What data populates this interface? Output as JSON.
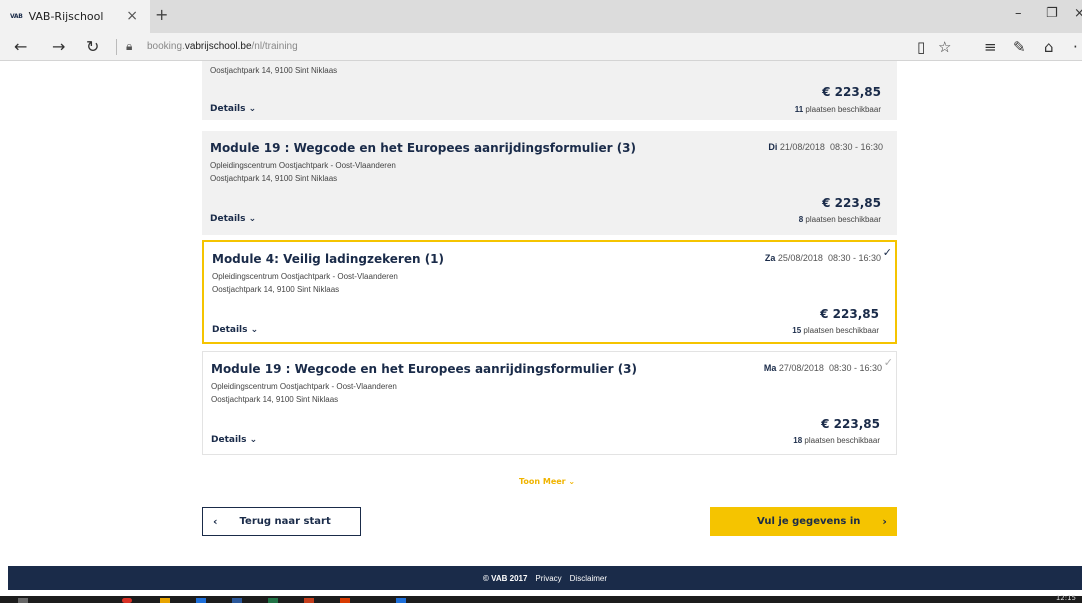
{
  "browser": {
    "tab_favicon": "VAB",
    "tab_title": "VAB-Rijschool",
    "tab_close": "×",
    "new_tab": "+",
    "url_prefix": "booking.",
    "url_domain": "vabrijschool.be",
    "url_path": "/nl/training"
  },
  "top_partial": {
    "address": "Oostjachtpark 14, 9100 Sint Niklaas",
    "price": "€ 223,85",
    "details": "Details",
    "avail_count": "11",
    "avail_text": "plaatsen beschikbaar"
  },
  "cards": [
    {
      "title": "Module 19 : Wegcode en het Europees aanrijdingsformulier (3)",
      "location": "Opleidingscentrum Oostjachtpark - Oost-Vlaanderen",
      "address": "Oostjachtpark 14, 9100 Sint Niklaas",
      "day": "Di",
      "date": "21/08/2018",
      "time": "08:30 - 16:30",
      "price": "€ 223,85",
      "details": "Details",
      "avail_count": "8",
      "avail_text": "plaatsen beschikbaar"
    },
    {
      "title": "Module 4: Veilig ladingzekeren (1)",
      "location": "Opleidingscentrum Oostjachtpark - Oost-Vlaanderen",
      "address": "Oostjachtpark 14, 9100 Sint Niklaas",
      "day": "Za",
      "date": "25/08/2018",
      "time": "08:30 - 16:30",
      "price": "€ 223,85",
      "details": "Details",
      "avail_count": "15",
      "avail_text": "plaatsen beschikbaar"
    },
    {
      "title": "Module 19 : Wegcode en het Europees aanrijdingsformulier (3)",
      "location": "Opleidingscentrum Oostjachtpark - Oost-Vlaanderen",
      "address": "Oostjachtpark 14, 9100 Sint Niklaas",
      "day": "Ma",
      "date": "27/08/2018",
      "time": "08:30 - 16:30",
      "price": "€ 223,85",
      "details": "Details",
      "avail_count": "18",
      "avail_text": "plaatsen beschikbaar"
    }
  ],
  "toon_meer": "Toon Meer",
  "back_button": "Terug naar start",
  "next_button": "Vul je gegevens in",
  "footer": {
    "copyright": "© VAB 2017",
    "privacy": "Privacy",
    "disclaimer": "Disclaimer"
  },
  "clock": "12:15",
  "colors": {
    "accent": "#f5c400",
    "navy": "#1a2b49",
    "card_bg": "#f1f1f1"
  }
}
